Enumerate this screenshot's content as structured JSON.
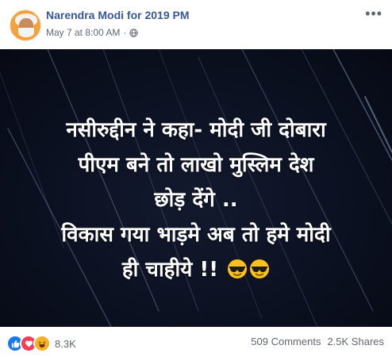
{
  "header": {
    "page_name": "Narendra Modi for 2019 PM",
    "timestamp": "May 7 at 8:00 AM",
    "separator": "·",
    "privacy_icon": "globe-icon",
    "more_icon": "more-options-icon"
  },
  "post": {
    "lines": [
      "नसीरुद्दीन ने कहा- मोदी जी दोबारा",
      "पीएम बने तो लाखो मुस्लिम देश",
      "छोड़ देंगे ..",
      "विकास गया भाड़मे अब तो हमे मोदी",
      "ही चाहीये !!"
    ],
    "emoji": [
      "sunglasses-face-icon",
      "sunglasses-face-icon"
    ]
  },
  "footer": {
    "reactions": [
      "like-reaction-icon",
      "love-reaction-icon",
      "haha-reaction-icon"
    ],
    "reaction_count": "8.3K",
    "comments": "509 Comments",
    "shares": "2.5K Shares"
  },
  "colors": {
    "link_blue": "#385898",
    "meta_gray": "#616770",
    "image_bg": "#0b1020"
  }
}
